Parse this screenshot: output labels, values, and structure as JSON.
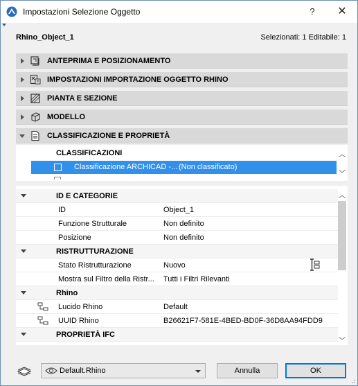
{
  "window": {
    "title": "Impostazioni Selezione Oggetto",
    "help_label": "?",
    "close_label": "✕"
  },
  "header": {
    "object_name": "Rhino_Object_1",
    "selection_info": "Selezionati: 1 Editabile: 1"
  },
  "sections": [
    {
      "label": "ANTEPRIMA E POSIZIONAMENTO",
      "icon": "preview-icon",
      "expanded": false
    },
    {
      "label": "IMPOSTAZIONI IMPORTAZIONE OGGETTO RHINO",
      "icon": "import-settings-icon",
      "expanded": false
    },
    {
      "label": "PIANTA E SEZIONE",
      "icon": "plan-section-icon",
      "expanded": false
    },
    {
      "label": "MODELLO",
      "icon": "model-cube-icon",
      "expanded": false
    },
    {
      "label": "CLASSIFICAZIONE E PROPRIETÀ",
      "icon": "document-icon",
      "expanded": true
    }
  ],
  "classification": {
    "header": "CLASSIFICAZIONI",
    "row": {
      "name": "Classificazione ARCHICAD -...",
      "value": "(Non classificato)"
    }
  },
  "properties": {
    "groups": [
      {
        "title": "ID E CATEGORIE",
        "rows": [
          {
            "name": "ID",
            "value": "Object_1"
          },
          {
            "name": "Funzione Strutturale",
            "value": "Non definito"
          },
          {
            "name": "Posizione",
            "value": "Non definito"
          }
        ]
      },
      {
        "title": "RISTRUTTURAZIONE",
        "rows": [
          {
            "name": "Stato Ristrutturazione",
            "value": "Nuovo"
          },
          {
            "name": "Mostra sul Filtro della Ristr...",
            "value": "Tutti i Filtri Rilevanti"
          }
        ]
      },
      {
        "title": "Rhino",
        "rows": [
          {
            "name": "Lucido Rhino",
            "value": "Default"
          },
          {
            "name": "UUID Rhino",
            "value": "B26621F7-581E-4BED-BD0F-36D8AA94FDD9"
          }
        ]
      },
      {
        "title": "PROPRIETÀ IFC",
        "rows": []
      }
    ]
  },
  "footer": {
    "preset": "Default.Rhino",
    "cancel_label": "Annulla",
    "ok_label": "OK"
  },
  "colors": {
    "selection": "#3390ea",
    "section_header": "#d9d9d9",
    "accent_border": "#0078d7"
  }
}
